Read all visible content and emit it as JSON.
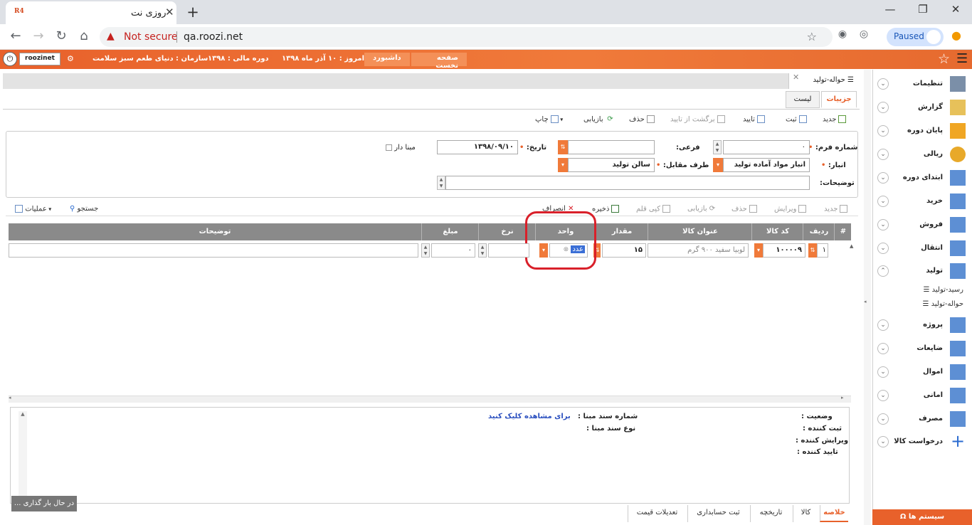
{
  "browser": {
    "tab_title": "روزی نت",
    "favicon_text": "R4",
    "not_secure": "Not secure",
    "url": "qa.roozi.net",
    "paused_label": "Paused"
  },
  "header": {
    "user": "roozinet",
    "home_button": "صفحه نخست",
    "dashboard_button": "داشبورد",
    "today": "امروز : ۱۰ آذر ماه ۱۳۹۸",
    "fiscal_period": "دوره مالی : ۱۳۹۸",
    "organization": "سازمان : دنیای طعم سبز سلامت"
  },
  "sidebar": {
    "items": [
      {
        "label": "تنظیمات"
      },
      {
        "label": "گزارش"
      },
      {
        "label": "پایان دوره"
      },
      {
        "label": "ریالی"
      },
      {
        "label": "ابتدای دوره"
      },
      {
        "label": "خرید"
      },
      {
        "label": "فروش"
      },
      {
        "label": "انتقال"
      },
      {
        "label": "تولید"
      },
      {
        "label": "پروژه"
      },
      {
        "label": "ضایعات"
      },
      {
        "label": "اموال"
      },
      {
        "label": "امانی"
      },
      {
        "label": "مصرف"
      },
      {
        "label": "درخواست کالا"
      }
    ],
    "subitems": [
      "رسید-تولید",
      "حواله-تولید"
    ],
    "system_button": "سیستم ها"
  },
  "page": {
    "doc_tab": "حواله-تولید",
    "tab_details": "جزییات",
    "tab_list": "لیست"
  },
  "toolbar": {
    "new": "جدید",
    "register": "ثبت",
    "approve": "تایید",
    "unapprove": "برگشت از تایید",
    "delete": "حذف",
    "refresh": "بازیابی",
    "print": "چاپ"
  },
  "form": {
    "form_number_label": "شماره فرم:",
    "form_number_value": "۰",
    "sub_label": "فرعی:",
    "date_label": "تاریخ:",
    "date_value": "۱۳۹۸/۰۹/۱۰",
    "base_label": "مبنا دار",
    "warehouse_label": "انبار:",
    "warehouse_value": "انبار مواد آماده تولید",
    "counterparty_label": "طرف مقابل:",
    "counterparty_value": "سالن تولید",
    "description_label": "توضیحات:"
  },
  "grid_toolbar": {
    "operations": "عملیات",
    "search": "جستجو",
    "save": "ذخیره",
    "cancel": "انصراف",
    "copy_row": "کپی قلم",
    "refresh": "بازیابی",
    "delete": "حذف",
    "edit": "ویرایش",
    "new": "جدید"
  },
  "grid": {
    "columns": [
      "#",
      "ردیف",
      "کد کالا",
      "عنوان کالا",
      "مقدار",
      "واحد",
      "نرخ",
      "مبلغ",
      "توضیحات"
    ],
    "row": {
      "row_no": "۱",
      "item_code": "۱۰۰۰۰۹",
      "item_title": "لوبیا سفید ۹۰۰ گرم",
      "quantity": "۱۵",
      "unit": "عدد",
      "rate": "",
      "amount": "۰",
      "description": ""
    }
  },
  "info": {
    "status_label": "وضعیت :",
    "creator_label": "ثبت کننده :",
    "editor_label": "ویرایش کننده :",
    "approver_label": "تایید کننده :",
    "base_doc_number_label": "شماره سند مبنا :",
    "base_doc_type_label": "نوع سند مبنا :",
    "view_link": "برای مشاهده کلیک کنید"
  },
  "bottom_tabs": [
    "خلاصه",
    "کالا",
    "تاریخچه",
    "ثبت حسابداری",
    "تعدیلات قیمت"
  ],
  "loading": "در حال بار گذاری ...",
  "colors": {
    "accent": "#e8612b",
    "highlight": "#d9202a",
    "link": "#2a4fbf"
  }
}
